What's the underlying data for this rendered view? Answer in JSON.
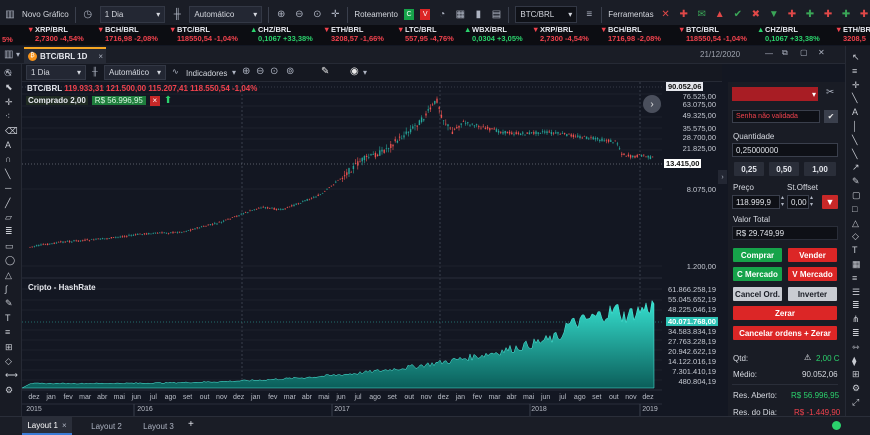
{
  "toolbar": {
    "new_chart": "Novo Gráfico",
    "interval": "1 Dia",
    "mode": "Automático",
    "roteamento": "Roteamento",
    "symbol": "BTC/BRL",
    "ferramentas": "Ferramentas",
    "partial_left": "5%"
  },
  "ticker": [
    {
      "name": "XRP/BRL",
      "value": "2,7300 -4,54%",
      "dir": "neg"
    },
    {
      "name": "BCH/BRL",
      "value": "1716,98 -2,08%",
      "dir": "neg"
    },
    {
      "name": "BTC/BRL",
      "value": "118550,54 -1,04%",
      "dir": "neg"
    },
    {
      "name": "CHZ/BRL",
      "value": "0,1067 +33,38%",
      "dir": "pos"
    },
    {
      "name": "ETH/BRL",
      "value": "3208,57 -1,66%",
      "dir": "neg"
    },
    {
      "name": "LTC/BRL",
      "value": "557,95 -4,76%",
      "dir": "neg"
    },
    {
      "name": "WBX/BRL",
      "value": "0,0304 +3,05%",
      "dir": "pos"
    },
    {
      "name": "XRP/BRL",
      "value": "2,7300 -4,54%",
      "dir": "neg"
    },
    {
      "name": "BCH/BRL",
      "value": "1716,98 -2,08%",
      "dir": "neg"
    },
    {
      "name": "BTC/BRL",
      "value": "118550,54 -1,04%",
      "dir": "neg"
    },
    {
      "name": "CHZ/BRL",
      "value": "0,1067 +33,38%",
      "dir": "pos"
    },
    {
      "name": "ETH/BRL",
      "value": "3208,5",
      "dir": "neg"
    }
  ],
  "tab": {
    "label": "BTC/BRL 1D",
    "date": "21/12/2020"
  },
  "chart_toolbar": {
    "interval": "1 Dia",
    "mode": "Automático",
    "indicators": "Indicadores"
  },
  "price_header": {
    "symbol": "BTC/BRL",
    "open": "119.933,31",
    "high": "121.500,00",
    "low": "115.207,41",
    "close": "118.550,54",
    "change": "-1,04%",
    "position": "Comprado 2,00",
    "position_value": "R$ 56.996,95"
  },
  "price_axis": {
    "ticks": [
      "76.525,00",
      "63.075,00",
      "49.325,00",
      "35.575,00",
      "28.700,00",
      "21.825,00",
      "8.075,00",
      "1.200,00"
    ],
    "top_badge": "90.052,06",
    "last_badge": "13.415,00"
  },
  "hashrate": {
    "title": "Cripto - HashRate",
    "ticks": [
      "61.866.258,19",
      "55.045.652,19",
      "48.225.046,19",
      "34.583.834,19",
      "27.763.228,19",
      "20.942.622,19",
      "14.122.016,19",
      "7.301.410,19",
      "480.804,19"
    ],
    "last_badge": "40.071.768,00"
  },
  "time_axis": {
    "months": [
      "dez",
      "jan",
      "fev",
      "mar",
      "abr",
      "mai",
      "jun",
      "jul",
      "ago",
      "set",
      "out",
      "nov",
      "dez",
      "jan",
      "fev",
      "mar",
      "abr",
      "mai",
      "jun",
      "jul",
      "ago",
      "set",
      "out",
      "nov",
      "dez",
      "jan",
      "fev",
      "mar",
      "abr",
      "mai",
      "jun",
      "jul",
      "ago",
      "set",
      "out",
      "nov",
      "dez"
    ],
    "years": [
      "2015",
      "2016",
      "2017",
      "2018",
      "2019"
    ]
  },
  "order_panel": {
    "asset_placeholder": "",
    "signature": "Senha não validada",
    "quantity_label": "Quantidade",
    "quantity": "0,25000000",
    "quick": [
      "0,25",
      "0,50",
      "1,00"
    ],
    "price_label": "Preço",
    "price": "118.999,9",
    "stop_label": "St.Offset",
    "stop": "0,00",
    "total_label": "Valor Total",
    "total": "R$ 29.749,99",
    "buy": "Comprar",
    "sell": "Vender",
    "buy_market": "C Mercado",
    "sell_market": "V Mercado",
    "cancel": "Cancel Ord.",
    "invert": "Inverter",
    "zero": "Zerar",
    "cancel_all": "Cancelar ordens + Zerar",
    "qty_label": "Qtd:",
    "qty_value": "2,00 C",
    "avg_label": "Médio:",
    "avg_value": "90.052,06",
    "open_label": "Res. Aberto:",
    "open_value": "R$ 56.996,95",
    "day_label": "Res. do Dia:",
    "day_value": "R$ -1.449,90"
  },
  "layouts": [
    "Layout 1",
    "Layout 2",
    "Layout 3"
  ],
  "colors": {
    "bg": "#131722",
    "up": "#26a69a",
    "down": "#ef5350",
    "buy": "#16a34a",
    "sell": "#dc2626",
    "teal": "#2ec4b6"
  }
}
